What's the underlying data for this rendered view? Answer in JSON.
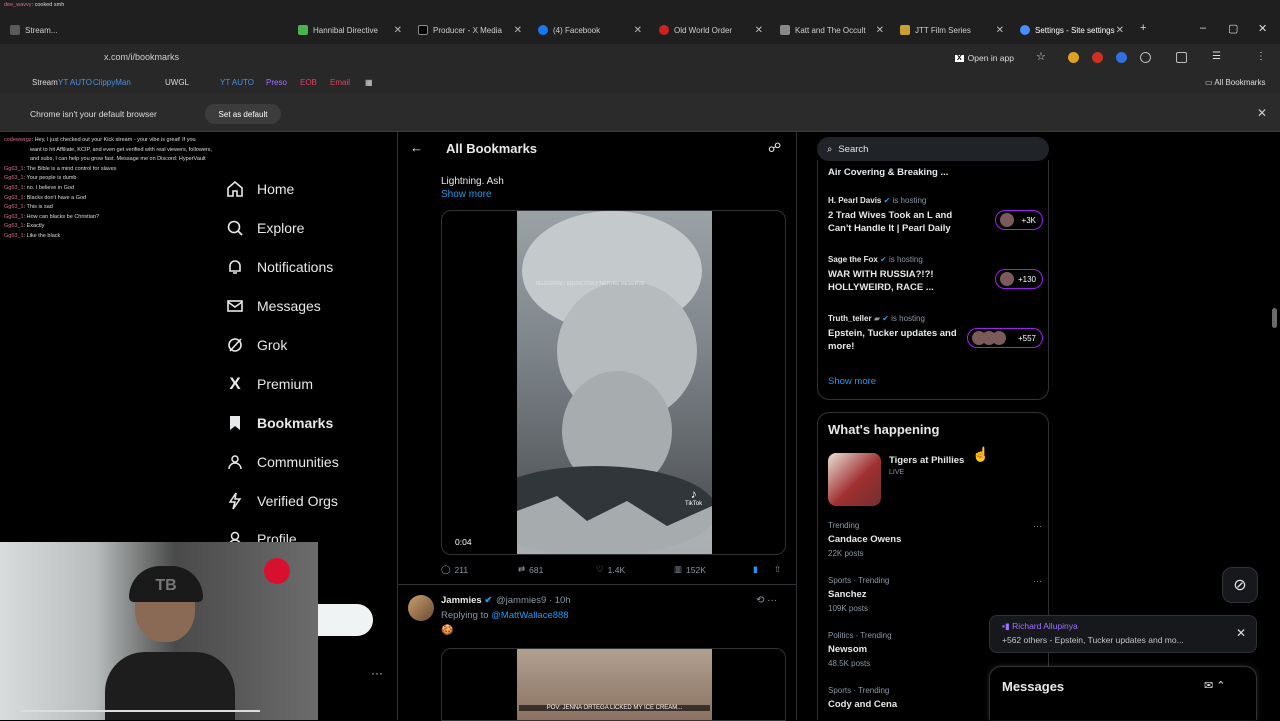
{
  "browser": {
    "tabs": [
      {
        "label": "Stream...",
        "color": "#5a5a5a"
      },
      {
        "label": "Hannibal Directive",
        "color": "#4caf50"
      },
      {
        "label": "Producer - X Media",
        "color": "#000000"
      },
      {
        "label": "(4) Facebook",
        "color": "#1877f2"
      },
      {
        "label": "Old World Order",
        "color": "#cc2222"
      },
      {
        "label": "Katt and The Occult",
        "color": "#888888"
      },
      {
        "label": "JTT Film Series",
        "color": "#c8a030"
      },
      {
        "label": "Settings - Site settings",
        "color": "#4a8cff"
      }
    ],
    "url": "x.com/i/bookmarks",
    "open_in_app": "Open in app",
    "bookmarks": [
      "Stream",
      "YT AUTO",
      "ClippyMan",
      "UWGL",
      "YT AUTO",
      "Preso",
      "EOB",
      "Email"
    ],
    "all_bookmarks": "All Bookmarks",
    "default_notice": "Chrome isn't your default browser",
    "set_default": "Set as default"
  },
  "chat": {
    "top_lines": [
      {
        "user": "dee_wavvy",
        "msg": "cooked smh"
      }
    ],
    "lines": [
      {
        "user": "codewwrgz",
        "msg": "Hey, I just checked out your Kick stream - your vibe is great! If you"
      },
      {
        "user": "",
        "msg": "want to hit Affiliate, KCIP, and even get verified with real viewers, followers,"
      },
      {
        "user": "",
        "msg": "and subs, I can help you grow fast. Message me on Discord: HyperVault"
      },
      {
        "user": "Gg63_1",
        "msg": "The Bible is a mind control for slaves"
      },
      {
        "user": "Gg63_1",
        "msg": "Your people is dumb"
      },
      {
        "user": "Gg63_1",
        "msg": "no. I believe in God"
      },
      {
        "user": "Gg63_1",
        "msg": "Blacks don't have a God"
      },
      {
        "user": "Gg63_1",
        "msg": "This is sad"
      },
      {
        "user": "Gg63_1",
        "msg": "How can blacks be Christian?"
      },
      {
        "user": "Gg63_1",
        "msg": "Exactly"
      },
      {
        "user": "Gg63_1",
        "msg": "Like the black"
      }
    ]
  },
  "nav": {
    "items": [
      {
        "label": "Home",
        "icon": "home-icon"
      },
      {
        "label": "Explore",
        "icon": "search-icon"
      },
      {
        "label": "Notifications",
        "icon": "bell-icon"
      },
      {
        "label": "Messages",
        "icon": "mail-icon"
      },
      {
        "label": "Grok",
        "icon": "grok-icon"
      },
      {
        "label": "Premium",
        "icon": "x-logo-icon"
      },
      {
        "label": "Bookmarks",
        "icon": "bookmark-icon"
      },
      {
        "label": "Communities",
        "icon": "communities-icon"
      },
      {
        "label": "Verified Orgs",
        "icon": "lightning-icon"
      },
      {
        "label": "Profile",
        "icon": "person-icon"
      }
    ]
  },
  "main": {
    "title": "All Bookmarks",
    "tweet1": {
      "text": "Lightning. Ash",
      "show_more": "Show more",
      "video_caption": "TELEGRAM / KRONOTSKY NATURE RESERVE",
      "watermark": "TikTok",
      "duration": "0:04",
      "replies": "211",
      "reposts": "681",
      "likes": "1.4K",
      "views": "152K"
    },
    "tweet2": {
      "name": "Jammies",
      "handle": "@jammies9 · 10h",
      "replying_prefix": "Replying to ",
      "replying_to": "@MattWallace888",
      "emoji": "🍪",
      "video_caption": "POV: JENNA ORTEGA LICKED MY ICE CREAM..."
    }
  },
  "right": {
    "search_placeholder": "Search",
    "spaces": [
      {
        "host": "",
        "title": "Air Covering & Breaking ...",
        "count": ""
      },
      {
        "host": "H. Pearl Davis",
        "hosting": "is hosting",
        "title": "2 Trad Wives Took an L and Can't Handle It | Pearl Daily",
        "count": "+3K"
      },
      {
        "host": "Sage the Fox",
        "hosting": "is hosting",
        "title": "WAR WITH RUSSIA?!?! HOLLYWEIRD, RACE ...",
        "count": "+130"
      },
      {
        "host": "Truth_teller",
        "hosting": "is hosting",
        "title": "Epstein, Tucker updates and more!",
        "count": "+557"
      }
    ],
    "show_more": "Show more",
    "whats_happening": "What's happening",
    "featured": {
      "name": "Tigers at Phillies",
      "status": "LIVE"
    },
    "trends": [
      {
        "meta": "Trending",
        "name": "Candace Owens",
        "posts": "22K posts"
      },
      {
        "meta": "Sports · Trending",
        "name": "Sanchez",
        "posts": "109K posts"
      },
      {
        "meta": "Politics · Trending",
        "name": "Newsom",
        "posts": "48.5K posts"
      },
      {
        "meta": "Sports · Trending",
        "name": "Cody and Cena",
        "posts": ""
      }
    ]
  },
  "toast": {
    "line1": "Richard Allupinya",
    "line2": "+562 others - Epstein, Tucker updates and mo..."
  },
  "messages_dock": {
    "title": "Messages"
  }
}
